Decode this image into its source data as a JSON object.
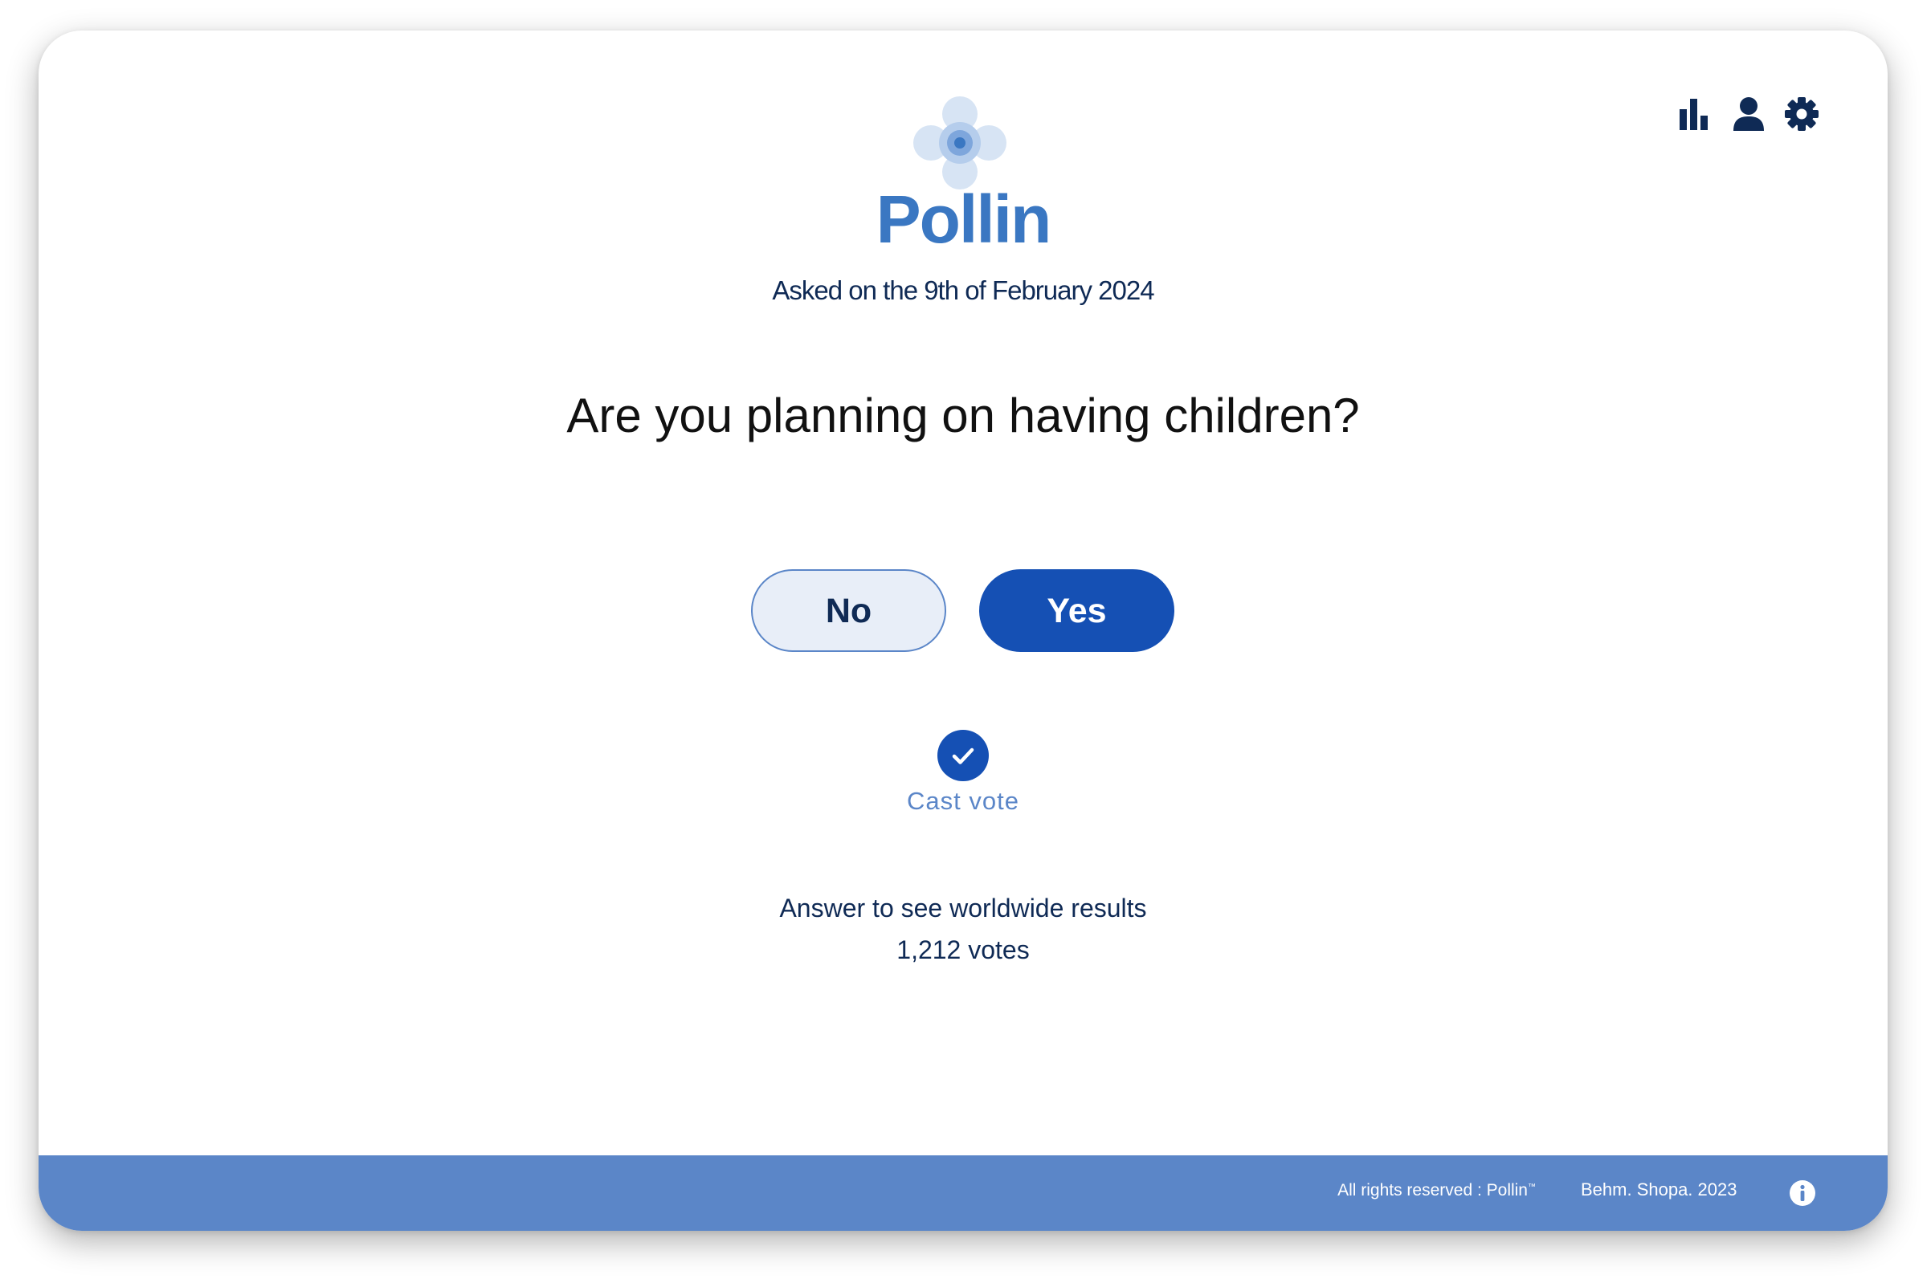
{
  "app": {
    "name": "Pollin",
    "logo_icon": "pollen-flower-icon"
  },
  "toolbar": {
    "icons": [
      "bar-chart-icon",
      "user-icon",
      "gear-icon"
    ]
  },
  "poll": {
    "asked_on": "Asked on the 9th of February 2024",
    "question": "Are you planning on having children?",
    "options": {
      "no_label": "No",
      "yes_label": "Yes",
      "selected": "Yes"
    },
    "cast_vote_label": "Cast vote",
    "results_prompt": "Answer to see worldwide results",
    "votes_count": "1,212 votes"
  },
  "footer": {
    "rights_text": "All rights reserved : Pollin",
    "trademark": "™",
    "credit": "Behm. Shopa.  2023",
    "info_icon": "info-icon"
  },
  "colors": {
    "brand": "#3a77c2",
    "primary": "#1550b4",
    "navy": "#0f2a55",
    "footer": "#5b86c8",
    "no_button_bg": "#e8eef8"
  }
}
